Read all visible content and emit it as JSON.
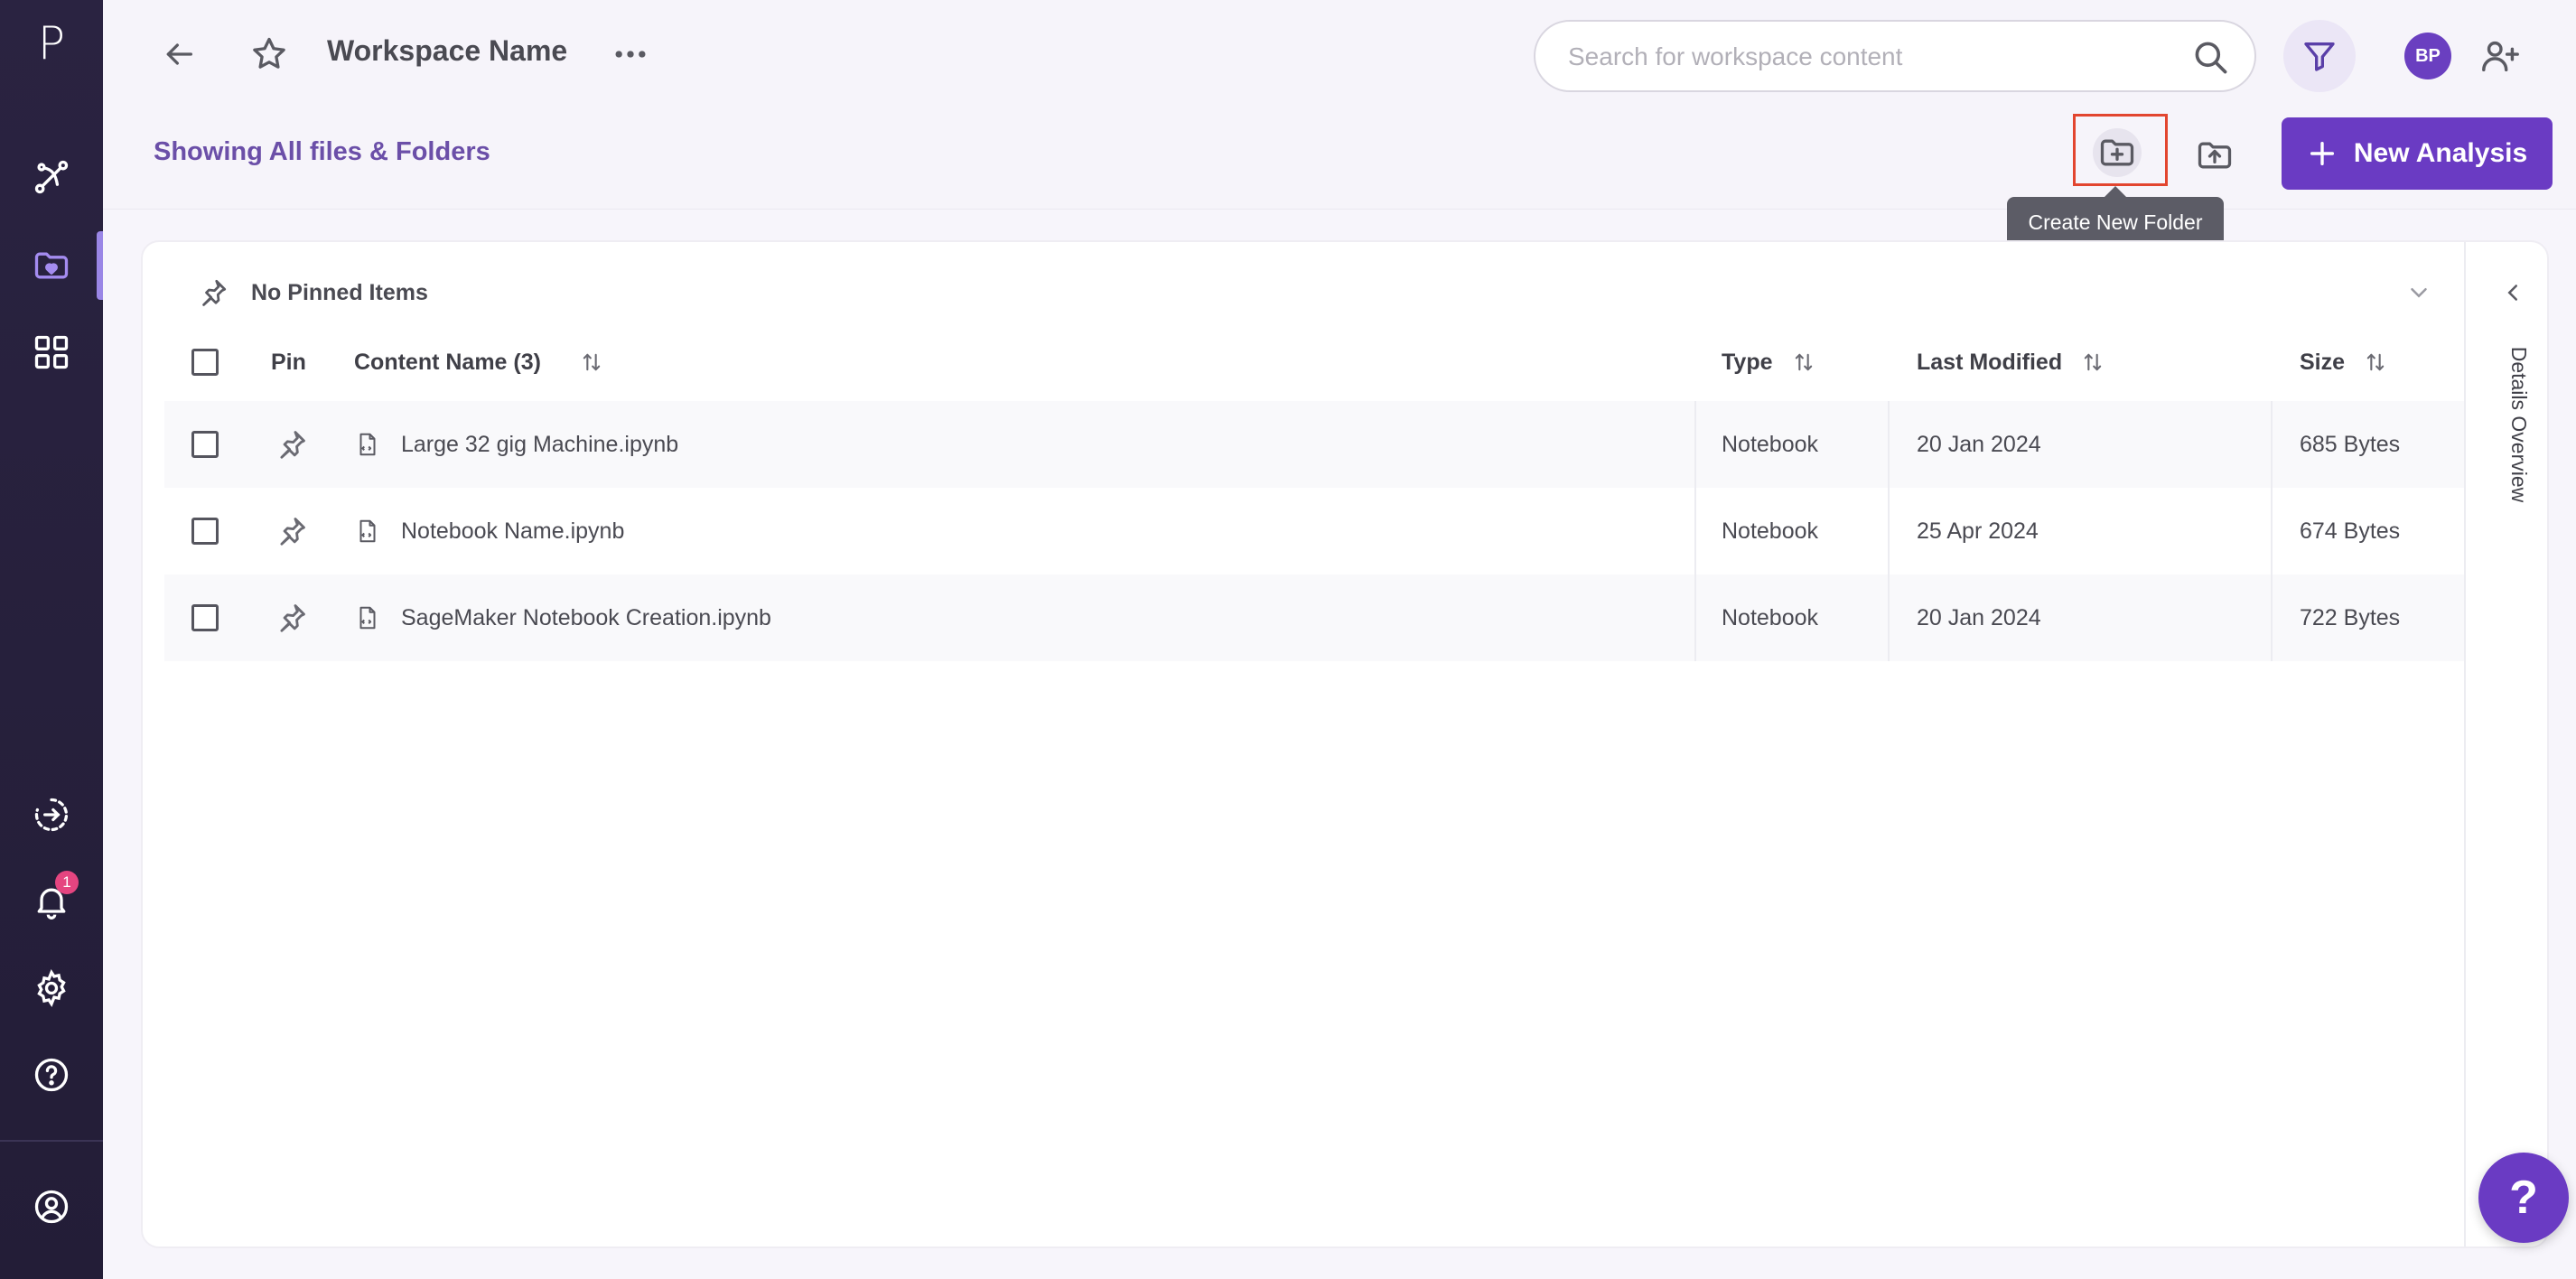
{
  "sidebar": {
    "logo": "P",
    "notification_count": "1"
  },
  "header": {
    "workspace_title": "Workspace Name",
    "search_placeholder": "Search for workspace content",
    "avatar_initials": "BP"
  },
  "subheader": {
    "showing_label": "Showing All files & Folders",
    "new_analysis_label": "New Analysis",
    "tooltip": "Create New Folder"
  },
  "panel": {
    "pinned_label": "No Pinned Items",
    "details_label": "Details Overview"
  },
  "table": {
    "columns": {
      "pin": "Pin",
      "name": "Content Name (3)",
      "type": "Type",
      "modified": "Last Modified",
      "size": "Size"
    },
    "rows": [
      {
        "name": "Large 32 gig Machine.ipynb",
        "type": "Notebook",
        "modified": "20 Jan 2024",
        "size": "685 Bytes"
      },
      {
        "name": "Notebook Name.ipynb",
        "type": "Notebook",
        "modified": "25 Apr 2024",
        "size": "674 Bytes"
      },
      {
        "name": "SageMaker Notebook Creation.ipynb",
        "type": "Notebook",
        "modified": "20 Jan 2024",
        "size": "722 Bytes"
      }
    ]
  },
  "help_fab": "?",
  "colors": {
    "sidebar": "#2a2341",
    "accent": "#6a3bc3",
    "highlight": "#e2452f",
    "badge": "#e54580"
  }
}
